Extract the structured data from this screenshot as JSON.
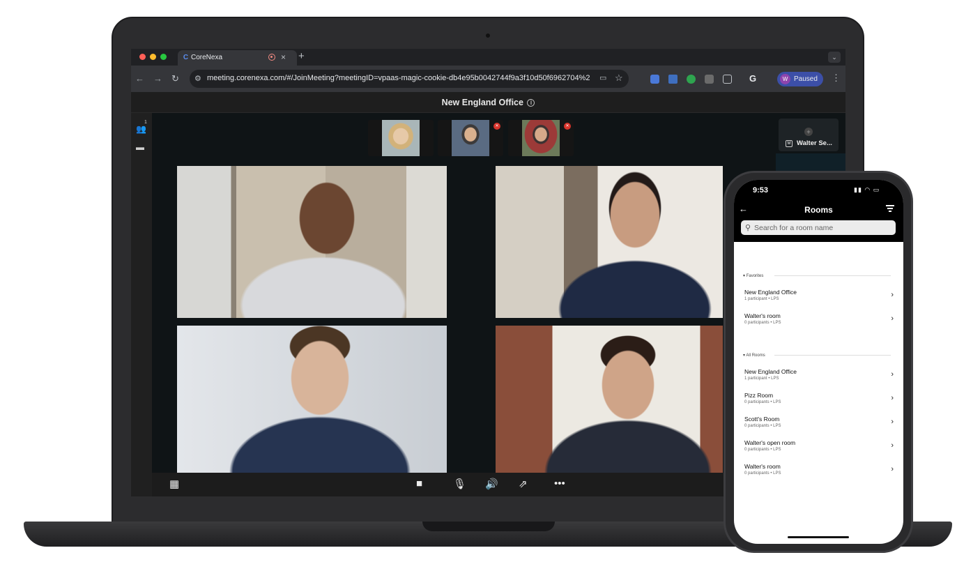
{
  "browser": {
    "tab_title": "CoreNexa",
    "tab_favicon": "corenexa-logo-icon",
    "new_tab": "+",
    "url": "meeting.corenexa.com/#/JoinMeeting?meetingID=vpaas-magic-cookie-db4e95b0042744f9a3f10d50f6962704%2F8...",
    "profile_initial": "W",
    "profile_label": "Paused",
    "google_icon": "G"
  },
  "meeting": {
    "title": "New England Office",
    "participants_badge": "1",
    "side_tile_name": "Walter Se...",
    "side_tile_badge": "M"
  },
  "phone": {
    "time": "9:53",
    "title": "Rooms",
    "search_placeholder": "Search for a room name",
    "favorites_label": "Favorites",
    "all_rooms_label": "All Rooms",
    "favorites": [
      {
        "name": "New England Office",
        "sub": "1 participant • LPS"
      },
      {
        "name": "Walter's room",
        "sub": "0 participants • LPS"
      }
    ],
    "all_rooms": [
      {
        "name": "New England Office",
        "sub": "1 participant • LPS"
      },
      {
        "name": "Pizz Room",
        "sub": "0 participants • LPS"
      },
      {
        "name": "Scott's Room",
        "sub": "0 participants • LPS"
      },
      {
        "name": "Walter's open room",
        "sub": "0 participants • LPS"
      },
      {
        "name": "Walter's room",
        "sub": "0 participants • LPS"
      }
    ]
  }
}
